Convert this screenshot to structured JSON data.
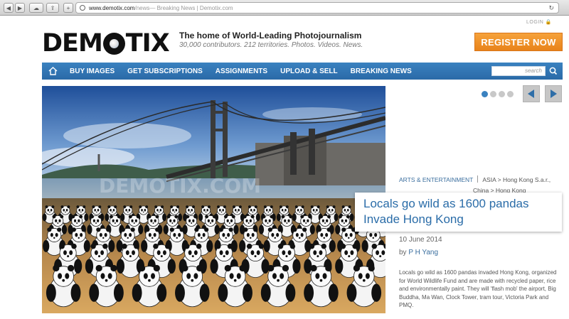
{
  "browser": {
    "url_host": "www.demotix.com",
    "url_path": "/news",
    "page_title": " — Breaking News | Demotix.com"
  },
  "header": {
    "login": "LOGIN",
    "logo_left": "DEM",
    "logo_right": "TIX",
    "tagline": "The home of World-Leading Photojournalism",
    "subline": "30,000 contributors. 212 territories. Photos. Videos. News.",
    "register": "REGISTER NOW"
  },
  "nav": {
    "items": [
      "BUY IMAGES",
      "GET SUBSCRIPTIONS",
      "ASSIGNMENTS",
      "UPLOAD & SELL",
      "BREAKING NEWS"
    ],
    "search_placeholder": "search"
  },
  "slider": {
    "current": 1,
    "total": 4,
    "watermark": "DEMOTIX.COM"
  },
  "article": {
    "category": "ARTS & ENTERTAINMENT",
    "location_1": "ASIA",
    "location_2": "Hong Kong S.a.r.,",
    "location_3": "China",
    "location_4": "Hong Kong",
    "headline": "Locals go wild as 1600 pandas Invade Hong Kong",
    "date": "10 June 2014",
    "by_prefix": "by",
    "author": "P H Yang",
    "summary": "Locals go wild as 1600 pandas invaded Hong Kong, organized for World Wildlife Fund and are made with recycled paper, rice and environmentally paint. They will 'flash mob' the airport, Big Buddha, Ma Wan, Clock Tower, tram tour, Victoria Park and PMQ."
  },
  "colors": {
    "nav_blue": "#2f74b4",
    "register_orange": "#f0922a",
    "link_blue": "#2a6ca8"
  }
}
